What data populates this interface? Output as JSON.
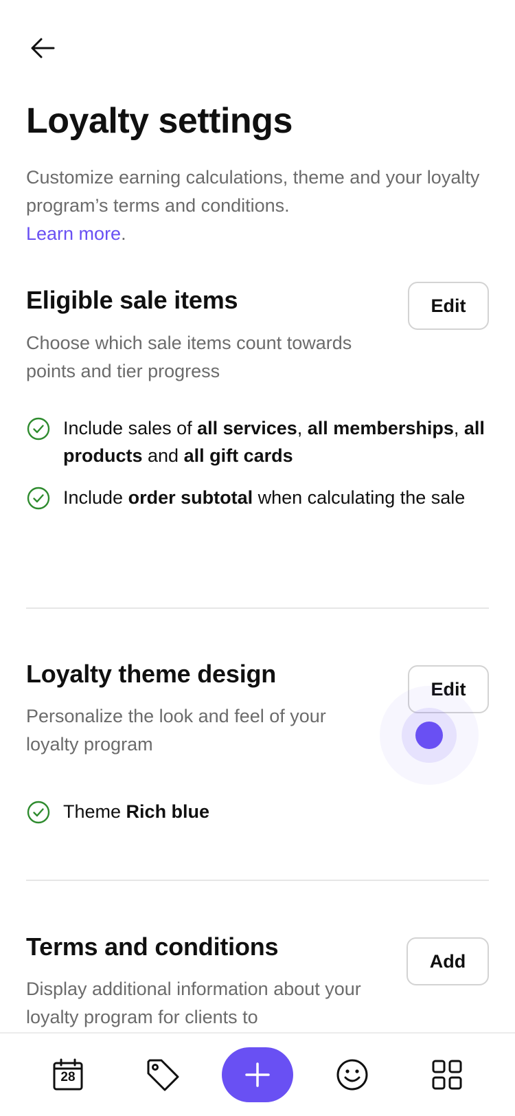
{
  "header": {
    "title": "Loyalty settings",
    "description": "Customize earning calculations, theme and your loyalty program’s terms and conditions.",
    "learn_more": "Learn more",
    "learn_more_suffix": "."
  },
  "sections": [
    {
      "title": "Eligible sale items",
      "description": "Choose which sale items count towards points and tier progress",
      "button_label": "Edit",
      "items": [
        {
          "t1": "Include sales of ",
          "b1": "all services",
          "t2": ", ",
          "b2": "all memberships",
          "t3": ", ",
          "b3": "all products",
          "t4": " and ",
          "b4": "all gift cards"
        },
        {
          "t1": "Include ",
          "b1": "order subtotal",
          "t2": " when calculating the sale"
        }
      ]
    },
    {
      "title": "Loyalty theme design",
      "description": "Personalize the look and feel of your loyalty program",
      "button_label": "Edit",
      "items": [
        {
          "t1": "Theme ",
          "b1": "Rich blue"
        }
      ]
    },
    {
      "title": "Terms and conditions",
      "description": "Display additional information about your loyalty program for clients to",
      "button_label": "Add"
    }
  ],
  "bottom_nav": {
    "calendar_day": "28",
    "items": [
      "calendar-icon",
      "tag-icon",
      "plus-icon",
      "smiley-icon",
      "grid-icon"
    ]
  },
  "colors": {
    "accent": "#6950f3",
    "check": "#2e8b2e",
    "text": "#101010",
    "muted": "#6b6b6b"
  }
}
